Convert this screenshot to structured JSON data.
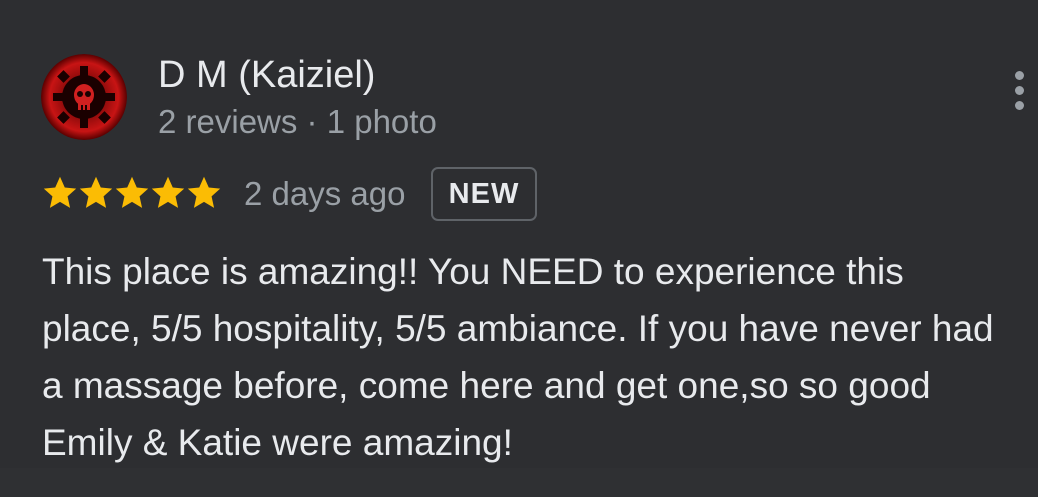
{
  "review": {
    "reviewer": {
      "name": "D M (Kaiziel)",
      "meta": "2 reviews · 1 photo",
      "avatar_icon": "red-gear-skull-avatar"
    },
    "rating": {
      "stars": 5,
      "max": 5,
      "color": "#fbbc04"
    },
    "time": "2 days ago",
    "badge": "NEW",
    "text": "This place is amazing!! You NEED to experience this place, 5/5 hospitality, 5/5 ambiance. If you have never had a massage before, come here and get one,so so good Emily & Katie were amazing!",
    "more_icon": "more-vert-icon"
  },
  "colors": {
    "background": "#2d2e31",
    "primary_text": "#e8eaed",
    "secondary_text": "#9aa0a6",
    "star": "#fbbc04"
  }
}
